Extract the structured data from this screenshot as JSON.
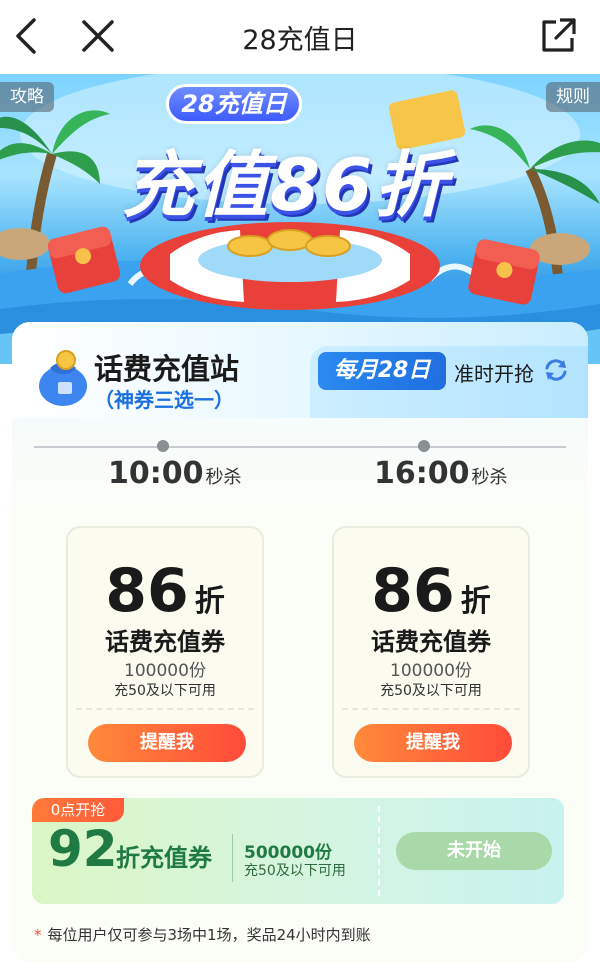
{
  "nav": {
    "title": "28充值日"
  },
  "hero": {
    "guide_label": "攻略",
    "rules_label": "规则",
    "badge": "28充值日",
    "headline": "充值86折"
  },
  "station": {
    "title": "话费充值站",
    "subtitle": "（神券三选一）",
    "monthly_badge": "每月28日",
    "ontime_text": "准时开抢"
  },
  "sessions": [
    {
      "time": "10:00",
      "suffix": "秒杀",
      "discount": "86",
      "discount_unit": "折",
      "coupon_name": "话费充值券",
      "count": "100000份",
      "condition": "充50及以下可用",
      "button": "提醒我"
    },
    {
      "time": "16:00",
      "suffix": "秒杀",
      "discount": "86",
      "discount_unit": "折",
      "coupon_name": "话费充值券",
      "count": "100000份",
      "condition": "充50及以下可用",
      "button": "提醒我"
    }
  ],
  "midnight": {
    "tag": "0点开抢",
    "discount": "92",
    "coupon_name": "折充值券",
    "count": "500000份",
    "condition": "充50及以下可用",
    "button": "未开始"
  },
  "footnote": {
    "asterisk": "*",
    "text": "每位用户仅可参与3场中1场，奖品24小时内到账"
  },
  "colors": {
    "accent_blue": "#1f6ee0",
    "button_orange": "#ff6a3a",
    "green_text": "#1f7a44"
  }
}
